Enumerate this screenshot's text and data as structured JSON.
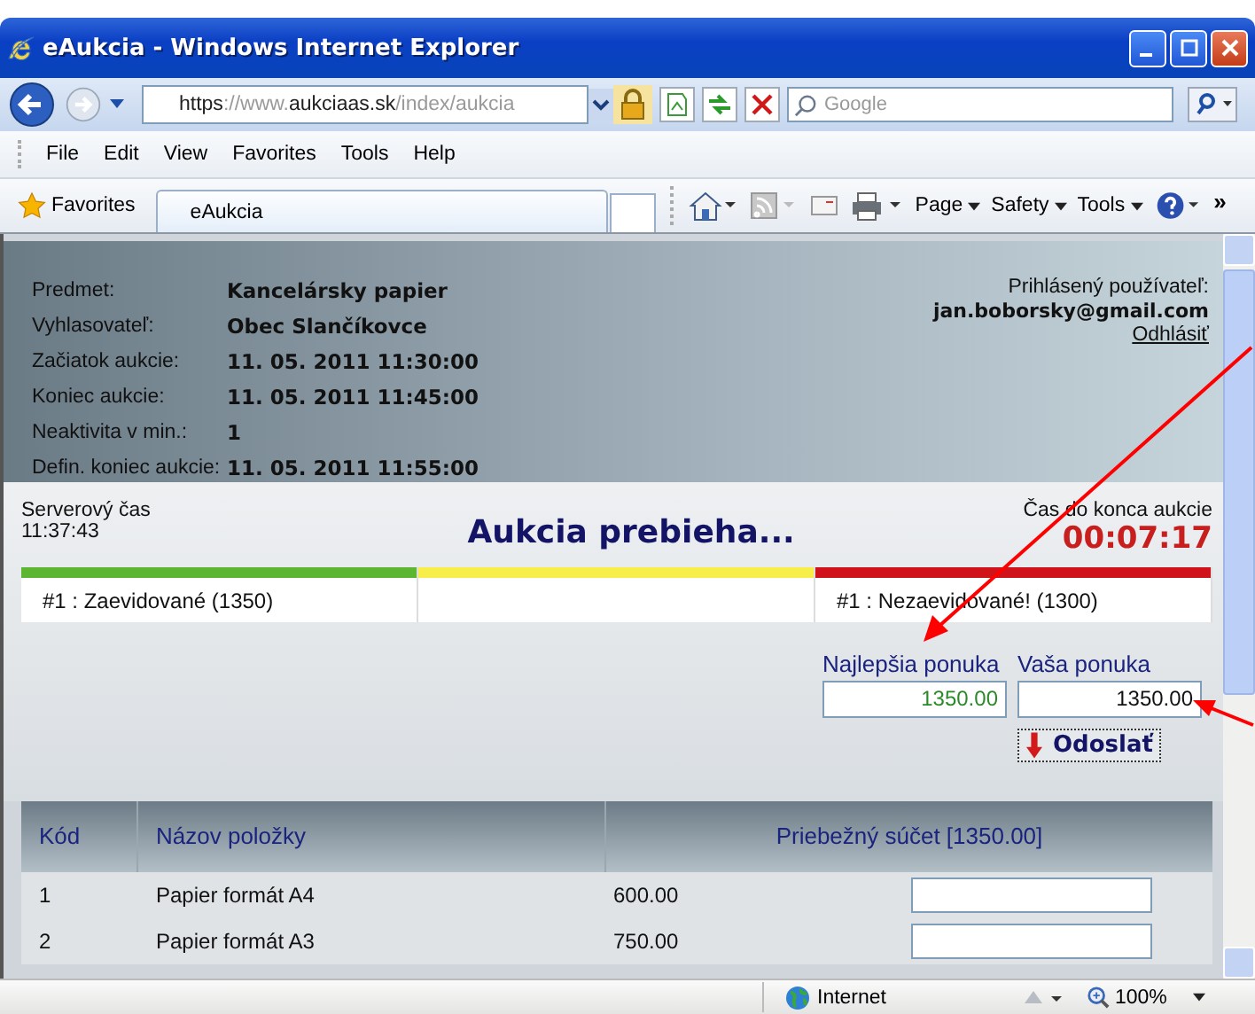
{
  "window": {
    "title": "eAukcia - Windows Internet Explorer"
  },
  "address_bar": {
    "url_parts": [
      {
        "text": "https",
        "strong": true
      },
      {
        "text": "://www.",
        "strong": false
      },
      {
        "text": "aukciaas.sk",
        "strong": true
      },
      {
        "text": "/index/aukcia",
        "strong": false
      }
    ]
  },
  "search": {
    "placeholder": "Google"
  },
  "menu": [
    "File",
    "Edit",
    "View",
    "Favorites",
    "Tools",
    "Help"
  ],
  "favorites_bar": {
    "favorites": "Favorites",
    "tab": "eAukcia",
    "commands": [
      "Page",
      "Safety",
      "Tools"
    ],
    "more": "»"
  },
  "auction": {
    "details": [
      {
        "label": "Predmet:",
        "value": "Kancelársky papier"
      },
      {
        "label": "Vyhlasovateľ:",
        "value": "Obec Slančíkovce"
      },
      {
        "label": "Začiatok aukcie:",
        "value": "11. 05. 2011 11:30:00"
      },
      {
        "label": "Koniec aukcie:",
        "value": "11. 05. 2011 11:45:00"
      },
      {
        "label": "Neaktivita v min.:",
        "value": "1"
      },
      {
        "label": "Defin. koniec aukcie:",
        "value": "11. 05. 2011 11:55:00"
      }
    ],
    "user_label": "Prihlásený používateľ:",
    "user": "jan.boborsky@gmail.com",
    "logout": "Odhlásiť",
    "server_time_label": "Serverový čas",
    "server_time": "11:37:43",
    "status": "Aukcia prebieha...",
    "remaining_label": "Čas do konca aukcie",
    "remaining": "00:07:17",
    "tiers": [
      {
        "color": "#5db632",
        "text": "#1 : Zaevidované (1350)"
      },
      {
        "color": "#f7ee4a"
      },
      {
        "color": "#d0131a",
        "text": "#1 : Nezaevidované! (1300)"
      }
    ],
    "best_bid_label": "Najlepšia ponuka",
    "best_bid": "1350.00",
    "your_bid_label": "Vaša ponuka",
    "your_bid": "1350.00",
    "send": "Odoslať"
  },
  "table": {
    "columns": [
      "Kód",
      "Názov položky",
      "Priebežný súčet [1350.00]"
    ],
    "rows": [
      {
        "code": "1",
        "name": "Papier formát A4",
        "amount": "600.00"
      },
      {
        "code": "2",
        "name": "Papier formát A3",
        "amount": "750.00"
      }
    ]
  },
  "status_bar": {
    "zone": "Internet",
    "zoom": "100%"
  }
}
